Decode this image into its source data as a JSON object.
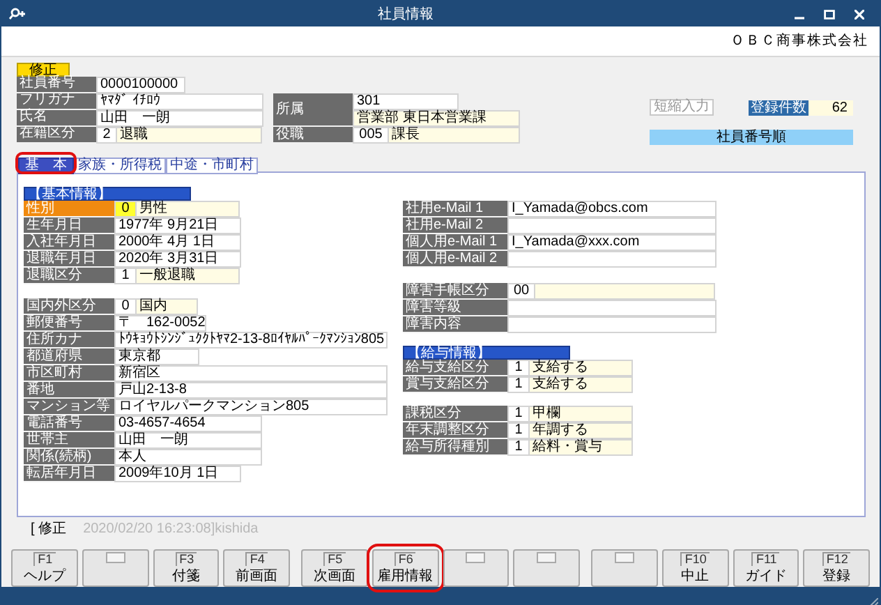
{
  "window": {
    "title": "社員情報"
  },
  "company": "ＯＢＣ商事株式会社",
  "mode_badge": "修正",
  "header_left": [
    {
      "label": "社員番号",
      "cells": [
        {
          "text": "0000100000",
          "kind": "text"
        }
      ]
    },
    {
      "label": "フリガナ",
      "cells": [
        {
          "text": "ﾔﾏﾀﾞ ｲﾁﾛｳ",
          "kind": "text"
        }
      ]
    },
    {
      "label": "氏名",
      "cells": [
        {
          "text": "山田　一朗",
          "kind": "text"
        }
      ]
    },
    {
      "label": "在籍区分",
      "cells": [
        {
          "text": "2",
          "kind": "code"
        },
        {
          "text": "退職",
          "kind": "name"
        }
      ]
    }
  ],
  "header_right": [
    {
      "label": "所属",
      "cells": [
        {
          "text": "301",
          "kind": "text"
        },
        {
          "text": "営業部 東日本営業課",
          "kind": "name"
        }
      ]
    },
    {
      "label": "役職",
      "cells": [
        {
          "text": "005",
          "kind": "code"
        },
        {
          "text": "課長",
          "kind": "name"
        }
      ]
    }
  ],
  "shortcut_button": "短縮入力",
  "count": {
    "label": "登録件数",
    "value": "62"
  },
  "sort_order": "社員番号順",
  "tabs": [
    {
      "label": "基　本",
      "selected": true,
      "highlighted": true
    },
    {
      "label": "家族・所得税",
      "selected": false,
      "highlighted": false
    },
    {
      "label": "中途・市町村",
      "selected": false,
      "highlighted": false
    }
  ],
  "left_groups": [
    {
      "heading": "【基本情報】",
      "rows": [
        {
          "label": "性別",
          "focused": true,
          "cells": [
            {
              "text": "0",
              "kind": "code",
              "focused": true
            },
            {
              "text": "男性",
              "kind": "name",
              "focused": false
            }
          ]
        },
        {
          "label": "生年月日",
          "focused": false,
          "cells": [
            {
              "text": "1977年  9月21日",
              "kind": "text",
              "focused": false
            }
          ]
        },
        {
          "label": "入社年月日",
          "focused": false,
          "cells": [
            {
              "text": "2000年  4月  1日",
              "kind": "text",
              "focused": false
            }
          ]
        },
        {
          "label": "退職年月日",
          "focused": false,
          "cells": [
            {
              "text": "2020年  3月31日",
              "kind": "text",
              "focused": false
            }
          ]
        },
        {
          "label": "退職区分",
          "focused": false,
          "cells": [
            {
              "text": "1",
              "kind": "code",
              "focused": false
            },
            {
              "text": "一般退職",
              "kind": "name",
              "focused": false
            }
          ]
        }
      ]
    },
    {
      "rows": [
        {
          "label": "国内外区分",
          "focused": false,
          "cells": [
            {
              "text": "0",
              "kind": "code",
              "focused": false
            },
            {
              "text": "国内",
              "kind": "name",
              "focused": false
            }
          ]
        },
        {
          "label": "郵便番号",
          "focused": false,
          "cells": [
            {
              "text": "〒　162-0052",
              "kind": "text",
              "focused": false
            }
          ]
        },
        {
          "label": "住所カナ",
          "focused": false,
          "cells": [
            {
              "text": "ﾄｳｷｮｳﾄｼﾝｼﾞｭｸｸﾄﾔﾏ2-13-8ﾛｲﾔﾙﾊﾟｰｸﾏﾝｼｮﾝ805",
              "kind": "text",
              "focused": false
            }
          ]
        },
        {
          "label": "都道府県",
          "focused": false,
          "cells": [
            {
              "text": "東京都",
              "kind": "text",
              "focused": false
            }
          ]
        },
        {
          "label": "市区町村",
          "focused": false,
          "cells": [
            {
              "text": "新宿区",
              "kind": "text",
              "focused": false
            }
          ]
        },
        {
          "label": "番地",
          "focused": false,
          "cells": [
            {
              "text": "戸山2-13-8",
              "kind": "text",
              "focused": false
            }
          ]
        },
        {
          "label": "マンション等",
          "focused": false,
          "cells": [
            {
              "text": "ロイヤルパークマンション805",
              "kind": "text",
              "focused": false
            }
          ]
        },
        {
          "label": "電話番号",
          "focused": false,
          "cells": [
            {
              "text": "03-4657-4654",
              "kind": "text",
              "focused": false
            }
          ]
        },
        {
          "label": "世帯主",
          "focused": false,
          "cells": [
            {
              "text": "山田　一朗",
              "kind": "text",
              "focused": false
            }
          ]
        },
        {
          "label": "関係(続柄)",
          "focused": false,
          "cells": [
            {
              "text": "本人",
              "kind": "text",
              "focused": false
            }
          ]
        },
        {
          "label": "転居年月日",
          "focused": false,
          "cells": [
            {
              "text": "2009年10月  1日",
              "kind": "text",
              "focused": false
            }
          ]
        }
      ]
    }
  ],
  "right_groups": [
    {
      "rows": [
        {
          "label": "社用e-Mail 1",
          "focused": false,
          "cells": [
            {
              "text": "I_Yamada@obcs.com",
              "kind": "text",
              "focused": false
            }
          ]
        },
        {
          "label": "社用e-Mail 2",
          "focused": false,
          "cells": [
            {
              "kind": "text",
              "focused": false
            }
          ]
        },
        {
          "label": "個人用e-Mail 1",
          "focused": false,
          "cells": [
            {
              "text": "I_Yamada@xxx.com",
              "kind": "text",
              "focused": false
            }
          ]
        },
        {
          "label": "個人用e-Mail 2",
          "focused": false,
          "cells": [
            {
              "kind": "text",
              "focused": false
            }
          ]
        }
      ]
    },
    {
      "rows": [
        {
          "label": "障害手帳区分",
          "focused": false,
          "cells": [
            {
              "text": "00",
              "kind": "code",
              "focused": false
            },
            {
              "kind": "name",
              "focused": false
            }
          ]
        },
        {
          "label": "障害等級",
          "focused": false,
          "cells": [
            {
              "kind": "text",
              "focused": false
            }
          ]
        },
        {
          "label": "障害内容",
          "focused": false,
          "cells": [
            {
              "kind": "text",
              "focused": false
            }
          ]
        }
      ]
    },
    {
      "heading": "【給与情報】",
      "rows": [
        {
          "label": "給与支給区分",
          "focused": false,
          "cells": [
            {
              "text": "1",
              "kind": "code",
              "focused": false
            },
            {
              "text": "支給する",
              "kind": "name",
              "focused": false
            }
          ]
        },
        {
          "label": "賞与支給区分",
          "focused": false,
          "cells": [
            {
              "text": "1",
              "kind": "code",
              "focused": false
            },
            {
              "text": "支給する",
              "kind": "name",
              "focused": false
            }
          ]
        }
      ]
    },
    {
      "rows": [
        {
          "label": "課税区分",
          "focused": false,
          "cells": [
            {
              "text": "1",
              "kind": "code",
              "focused": false
            },
            {
              "text": "甲欄",
              "kind": "name",
              "focused": false
            }
          ]
        },
        {
          "label": "年末調整区分",
          "focused": false,
          "cells": [
            {
              "text": "1",
              "kind": "code",
              "focused": false
            },
            {
              "text": "年調する",
              "kind": "name",
              "focused": false
            }
          ]
        },
        {
          "label": "給与所得種別",
          "focused": false,
          "cells": [
            {
              "text": "1",
              "kind": "code",
              "focused": false
            },
            {
              "text": "給料・賞与",
              "kind": "name",
              "focused": false
            }
          ]
        }
      ]
    }
  ],
  "history": {
    "mode": "[ 修正",
    "timestamp": "2020/02/20 16:23:08]",
    "user": "kishida"
  },
  "function_keys": [
    {
      "kind": "key",
      "key": "F1",
      "label": "ヘルプ",
      "highlighted": false
    },
    {
      "kind": "blank",
      "highlighted": false
    },
    {
      "kind": "key",
      "key": "F3",
      "label": "付箋",
      "highlighted": false
    },
    {
      "kind": "key",
      "key": "F4",
      "label": "前画面",
      "highlighted": false
    },
    {
      "kind": "key",
      "key": "F5",
      "label": "次画面",
      "highlighted": false
    },
    {
      "kind": "key",
      "key": "F6",
      "label": "雇用情報",
      "highlighted": true
    },
    {
      "kind": "blank",
      "highlighted": false
    },
    {
      "kind": "blank",
      "highlighted": false
    },
    {
      "kind": "blank",
      "highlighted": false
    },
    {
      "kind": "key",
      "key": "F10",
      "label": "中止",
      "highlighted": false
    },
    {
      "kind": "key",
      "key": "F11",
      "label": "ガイド",
      "highlighted": false
    },
    {
      "kind": "key",
      "key": "F12",
      "label": "登録",
      "highlighted": false
    }
  ]
}
